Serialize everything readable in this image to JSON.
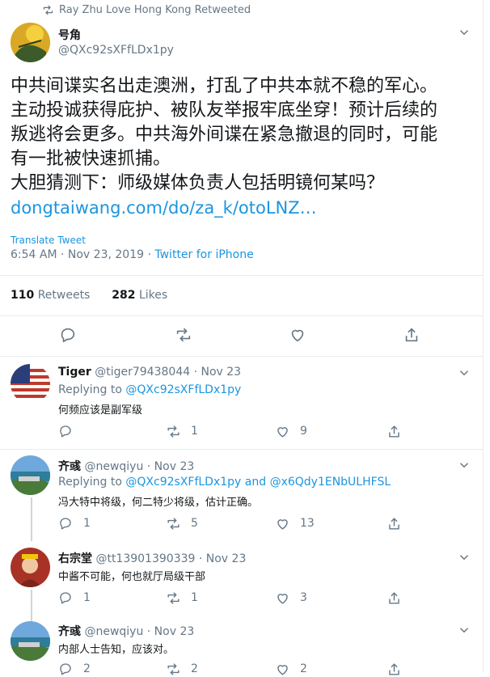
{
  "retweet_banner": "Ray Zhu Love Hong Kong Retweeted",
  "main_tweet": {
    "display_name": "号角",
    "handle": "@QXc92sXFfLDx1py",
    "lines": [
      "中共间谍实名出走澳洲，打乱了中共本就不稳的军心。",
      "主动投诚获得庇护、被队友举报牢底坐穿！预计后续的",
      "叛逃将会更多。中共海外间谍在紧急撤退的同时，可能",
      "有一批被快速抓捕。",
      "大胆猜测下：师级媒体负责人包括明镜何某吗？"
    ],
    "link": "dongtaiwang.com/do/za_k/otoLNZ…",
    "translate": "Translate Tweet",
    "timestamp": "6:54 AM · Nov 23, 2019 · ",
    "source": "Twitter for iPhone",
    "retweets_count": "110",
    "retweets_label": "Retweets",
    "likes_count": "282",
    "likes_label": "Likes"
  },
  "replies": [
    {
      "name": "Tiger",
      "meta": "@tiger79438044 · Nov 23",
      "replying_prefix": "Replying to ",
      "replying_to": "@QXc92sXFfLDx1py",
      "text": "何频应该是副军级",
      "reply_count": "",
      "retweet_count": "1",
      "like_count": "9"
    },
    {
      "name": "齐彧",
      "meta": "@newqiyu · Nov 23",
      "replying_prefix": "Replying to ",
      "replying_to": "@QXc92sXFfLDx1py and @x6Qdy1ENbULHFSL",
      "text": "冯大特中将级，何二特少将级，估计正确。",
      "reply_count": "1",
      "retweet_count": "5",
      "like_count": "13"
    },
    {
      "name": "右宗堂",
      "meta": "@tt13901390339 · Nov 23",
      "text": "中酱不可能，何也就厅局级干部",
      "reply_count": "1",
      "retweet_count": "1",
      "like_count": "3"
    },
    {
      "name": "齐彧",
      "meta": "@newqiyu · Nov 23",
      "text": "内部人士告知，应该对。",
      "reply_count": "2",
      "retweet_count": "2",
      "like_count": "2"
    }
  ],
  "colors": {
    "link": "#1b95e0",
    "muted": "#657786",
    "text": "#14171a"
  }
}
